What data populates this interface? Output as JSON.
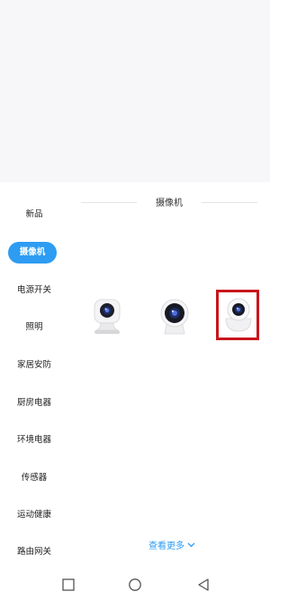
{
  "sheet": {
    "title": "摄像机",
    "see_more": "查看更多"
  },
  "sidebar": {
    "items": [
      {
        "label": "新品"
      },
      {
        "label": "摄像机",
        "active": true
      },
      {
        "label": "电源开关"
      },
      {
        "label": "照明"
      },
      {
        "label": "家居安防"
      },
      {
        "label": "厨房电器"
      },
      {
        "label": "环境电器"
      },
      {
        "label": "传感器"
      },
      {
        "label": "运动健康"
      },
      {
        "label": "路由网关"
      }
    ]
  },
  "products": [
    {
      "icon": "square-camera-icon"
    },
    {
      "icon": "round-camera-icon"
    },
    {
      "icon": "ptz-camera-icon",
      "highlighted": true
    }
  ],
  "colors": {
    "accent": "#2d9cf2",
    "highlight_border": "#c8161d"
  },
  "navbar": {
    "icons": [
      "recent-apps-icon",
      "home-icon",
      "back-icon"
    ]
  }
}
